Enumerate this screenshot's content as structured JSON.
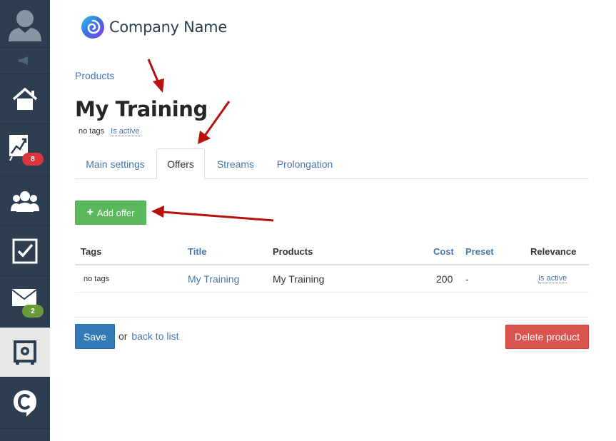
{
  "sidebar": {
    "badges": {
      "analytics": "8",
      "messages": "2"
    }
  },
  "header": {
    "company_name": "Company Name"
  },
  "breadcrumb": {
    "products": "Products"
  },
  "page": {
    "title": "My Training",
    "tags": "no tags",
    "status": "Is active"
  },
  "tabs": [
    {
      "label": "Main settings"
    },
    {
      "label": "Offers"
    },
    {
      "label": "Streams"
    },
    {
      "label": "Prolongation"
    }
  ],
  "add_offer": {
    "plus": "+",
    "label": "Add offer"
  },
  "table": {
    "columns": [
      "Tags",
      "Title",
      "Products",
      "Cost",
      "Preset",
      "Relevance"
    ],
    "rows": [
      {
        "tags": "no tags",
        "title": "My Training",
        "products": "My Training",
        "cost": "200",
        "preset": "-",
        "relevance": "Is active"
      }
    ]
  },
  "footer": {
    "save_label": "Save",
    "or_text": "or",
    "back_label": "back to list",
    "delete_label": "Delete product"
  },
  "colors": {
    "sidebar": "#2d3e50",
    "link": "#4a76a8",
    "success": "#5cb85c",
    "primary": "#337ab7",
    "danger": "#d9534f",
    "badge_red": "#d9363e",
    "badge_green": "#6a9a3a",
    "annotation_arrow": "#b80f0f"
  }
}
